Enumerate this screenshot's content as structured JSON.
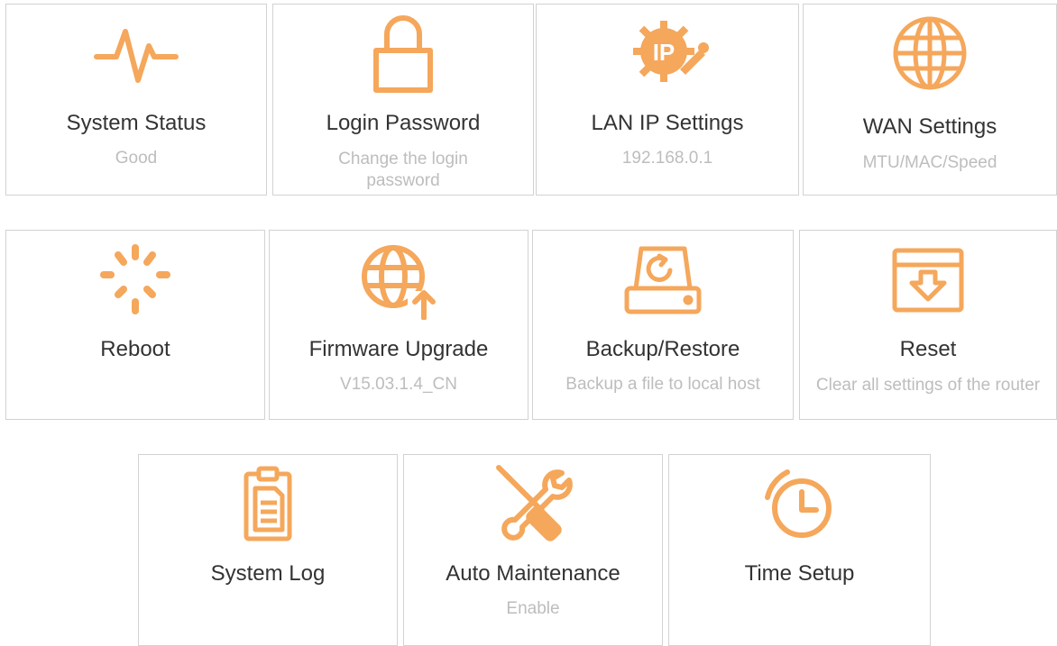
{
  "accent_color": "#f5a75b",
  "tiles": {
    "system_status": {
      "title": "System Status",
      "sub": "Good",
      "icon": "pulse-icon"
    },
    "login_password": {
      "title": "Login Password",
      "sub": "Change the login password",
      "icon": "lock-icon"
    },
    "lan_ip": {
      "title": "LAN IP Settings",
      "sub": "192.168.0.1",
      "icon": "ip-gear-icon"
    },
    "wan": {
      "title": "WAN Settings",
      "sub": "MTU/MAC/Speed",
      "icon": "globe-icon"
    },
    "reboot": {
      "title": "Reboot",
      "sub": "",
      "icon": "spinner-icon"
    },
    "firmware": {
      "title": "Firmware Upgrade",
      "sub": "V15.03.1.4_CN",
      "icon": "globe-upload-icon"
    },
    "backup": {
      "title": "Backup/Restore",
      "sub": "Backup a file to local host",
      "icon": "drive-refresh-icon"
    },
    "reset": {
      "title": "Reset",
      "sub": "Clear all settings of the router",
      "icon": "box-arrow-down-icon"
    },
    "system_log": {
      "title": "System Log",
      "sub": "",
      "icon": "clipboard-icon"
    },
    "auto_maint": {
      "title": "Auto Maintenance",
      "sub": "Enable",
      "icon": "tools-icon"
    },
    "time_setup": {
      "title": "Time Setup",
      "sub": "",
      "icon": "clock-icon"
    }
  }
}
